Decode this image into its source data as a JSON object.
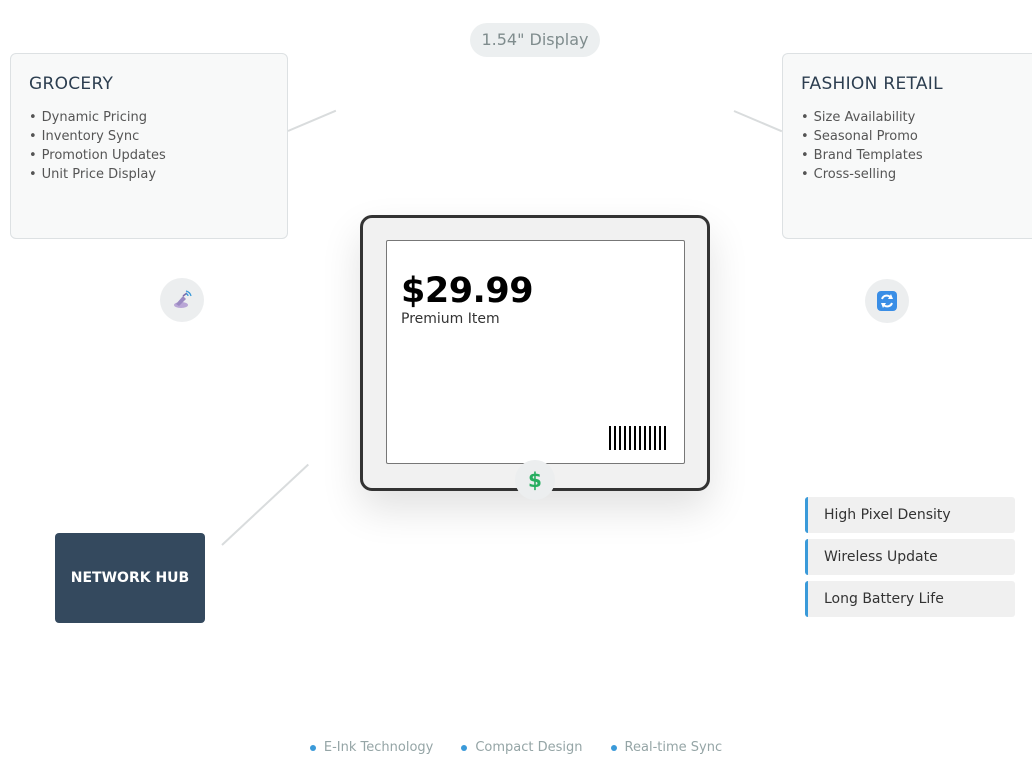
{
  "display_size_label": "1.54\" Display",
  "cards": {
    "grocery": {
      "title": "GROCERY",
      "items": [
        "Dynamic Pricing",
        "Inventory Sync",
        "Promotion Updates",
        "Unit Price Display"
      ]
    },
    "fashion": {
      "title": "FASHION RETAIL",
      "items": [
        "Size Availability",
        "Seasonal Promo",
        "Brand Templates",
        "Cross-selling"
      ]
    }
  },
  "device": {
    "price": "$29.99",
    "item_name": "Premium Item",
    "badge_symbol": "$"
  },
  "hub": {
    "label": "NETWORK HUB"
  },
  "features": [
    "High Pixel Density",
    "Wireless Update",
    "Long Battery Life"
  ],
  "footer_tags": [
    "E-Ink Technology",
    "Compact Design",
    "Real-time Sync"
  ],
  "icons": {
    "left_round": "satellite-antenna-icon",
    "right_round": "refresh-icon",
    "badge": "dollar-icon"
  },
  "colors": {
    "accent": "#3a9ad9",
    "hub_bg": "#34495e",
    "dollar": "#27ae60"
  }
}
